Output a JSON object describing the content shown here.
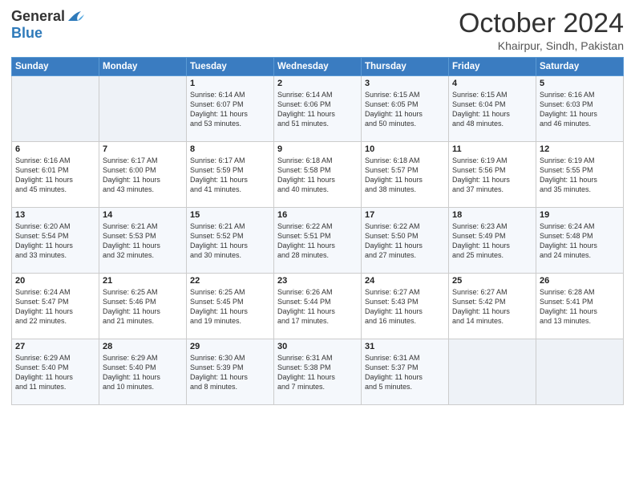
{
  "logo": {
    "general": "General",
    "blue": "Blue"
  },
  "header": {
    "month": "October 2024",
    "location": "Khairpur, Sindh, Pakistan"
  },
  "weekdays": [
    "Sunday",
    "Monday",
    "Tuesday",
    "Wednesday",
    "Thursday",
    "Friday",
    "Saturday"
  ],
  "weeks": [
    [
      {
        "day": "",
        "text": ""
      },
      {
        "day": "",
        "text": ""
      },
      {
        "day": "1",
        "text": "Sunrise: 6:14 AM\nSunset: 6:07 PM\nDaylight: 11 hours\nand 53 minutes."
      },
      {
        "day": "2",
        "text": "Sunrise: 6:14 AM\nSunset: 6:06 PM\nDaylight: 11 hours\nand 51 minutes."
      },
      {
        "day": "3",
        "text": "Sunrise: 6:15 AM\nSunset: 6:05 PM\nDaylight: 11 hours\nand 50 minutes."
      },
      {
        "day": "4",
        "text": "Sunrise: 6:15 AM\nSunset: 6:04 PM\nDaylight: 11 hours\nand 48 minutes."
      },
      {
        "day": "5",
        "text": "Sunrise: 6:16 AM\nSunset: 6:03 PM\nDaylight: 11 hours\nand 46 minutes."
      }
    ],
    [
      {
        "day": "6",
        "text": "Sunrise: 6:16 AM\nSunset: 6:01 PM\nDaylight: 11 hours\nand 45 minutes."
      },
      {
        "day": "7",
        "text": "Sunrise: 6:17 AM\nSunset: 6:00 PM\nDaylight: 11 hours\nand 43 minutes."
      },
      {
        "day": "8",
        "text": "Sunrise: 6:17 AM\nSunset: 5:59 PM\nDaylight: 11 hours\nand 41 minutes."
      },
      {
        "day": "9",
        "text": "Sunrise: 6:18 AM\nSunset: 5:58 PM\nDaylight: 11 hours\nand 40 minutes."
      },
      {
        "day": "10",
        "text": "Sunrise: 6:18 AM\nSunset: 5:57 PM\nDaylight: 11 hours\nand 38 minutes."
      },
      {
        "day": "11",
        "text": "Sunrise: 6:19 AM\nSunset: 5:56 PM\nDaylight: 11 hours\nand 37 minutes."
      },
      {
        "day": "12",
        "text": "Sunrise: 6:19 AM\nSunset: 5:55 PM\nDaylight: 11 hours\nand 35 minutes."
      }
    ],
    [
      {
        "day": "13",
        "text": "Sunrise: 6:20 AM\nSunset: 5:54 PM\nDaylight: 11 hours\nand 33 minutes."
      },
      {
        "day": "14",
        "text": "Sunrise: 6:21 AM\nSunset: 5:53 PM\nDaylight: 11 hours\nand 32 minutes."
      },
      {
        "day": "15",
        "text": "Sunrise: 6:21 AM\nSunset: 5:52 PM\nDaylight: 11 hours\nand 30 minutes."
      },
      {
        "day": "16",
        "text": "Sunrise: 6:22 AM\nSunset: 5:51 PM\nDaylight: 11 hours\nand 28 minutes."
      },
      {
        "day": "17",
        "text": "Sunrise: 6:22 AM\nSunset: 5:50 PM\nDaylight: 11 hours\nand 27 minutes."
      },
      {
        "day": "18",
        "text": "Sunrise: 6:23 AM\nSunset: 5:49 PM\nDaylight: 11 hours\nand 25 minutes."
      },
      {
        "day": "19",
        "text": "Sunrise: 6:24 AM\nSunset: 5:48 PM\nDaylight: 11 hours\nand 24 minutes."
      }
    ],
    [
      {
        "day": "20",
        "text": "Sunrise: 6:24 AM\nSunset: 5:47 PM\nDaylight: 11 hours\nand 22 minutes."
      },
      {
        "day": "21",
        "text": "Sunrise: 6:25 AM\nSunset: 5:46 PM\nDaylight: 11 hours\nand 21 minutes."
      },
      {
        "day": "22",
        "text": "Sunrise: 6:25 AM\nSunset: 5:45 PM\nDaylight: 11 hours\nand 19 minutes."
      },
      {
        "day": "23",
        "text": "Sunrise: 6:26 AM\nSunset: 5:44 PM\nDaylight: 11 hours\nand 17 minutes."
      },
      {
        "day": "24",
        "text": "Sunrise: 6:27 AM\nSunset: 5:43 PM\nDaylight: 11 hours\nand 16 minutes."
      },
      {
        "day": "25",
        "text": "Sunrise: 6:27 AM\nSunset: 5:42 PM\nDaylight: 11 hours\nand 14 minutes."
      },
      {
        "day": "26",
        "text": "Sunrise: 6:28 AM\nSunset: 5:41 PM\nDaylight: 11 hours\nand 13 minutes."
      }
    ],
    [
      {
        "day": "27",
        "text": "Sunrise: 6:29 AM\nSunset: 5:40 PM\nDaylight: 11 hours\nand 11 minutes."
      },
      {
        "day": "28",
        "text": "Sunrise: 6:29 AM\nSunset: 5:40 PM\nDaylight: 11 hours\nand 10 minutes."
      },
      {
        "day": "29",
        "text": "Sunrise: 6:30 AM\nSunset: 5:39 PM\nDaylight: 11 hours\nand 8 minutes."
      },
      {
        "day": "30",
        "text": "Sunrise: 6:31 AM\nSunset: 5:38 PM\nDaylight: 11 hours\nand 7 minutes."
      },
      {
        "day": "31",
        "text": "Sunrise: 6:31 AM\nSunset: 5:37 PM\nDaylight: 11 hours\nand 5 minutes."
      },
      {
        "day": "",
        "text": ""
      },
      {
        "day": "",
        "text": ""
      }
    ]
  ]
}
